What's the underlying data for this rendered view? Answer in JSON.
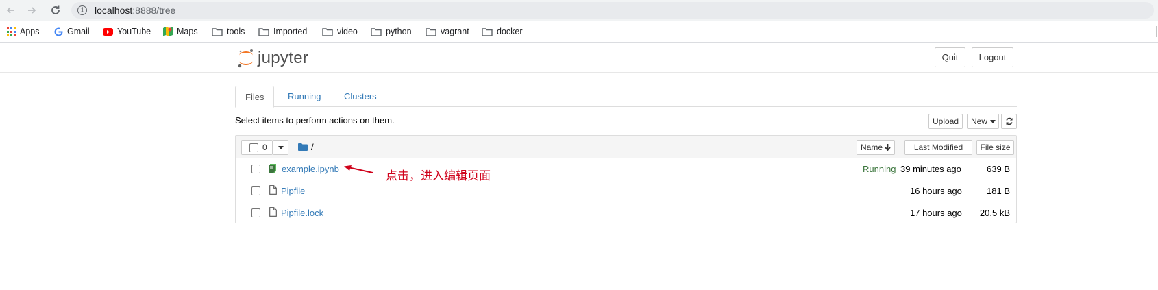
{
  "browser": {
    "url_host": "localhost",
    "url_path": ":8888/tree",
    "bookmarks": [
      {
        "label": "Apps",
        "icon": "apps-grid-icon"
      },
      {
        "label": "Gmail",
        "icon": "google-g-icon"
      },
      {
        "label": "YouTube",
        "icon": "youtube-icon"
      },
      {
        "label": "Maps",
        "icon": "maps-icon"
      },
      {
        "label": "tools",
        "icon": "folder-icon"
      },
      {
        "label": "Imported",
        "icon": "folder-icon"
      },
      {
        "label": "video",
        "icon": "folder-icon"
      },
      {
        "label": "python",
        "icon": "folder-icon"
      },
      {
        "label": "vagrant",
        "icon": "folder-icon"
      },
      {
        "label": "docker",
        "icon": "folder-icon"
      }
    ]
  },
  "header": {
    "logo_text": "jupyter",
    "quit_label": "Quit",
    "logout_label": "Logout"
  },
  "tabs": [
    {
      "label": "Files",
      "active": true
    },
    {
      "label": "Running",
      "active": false
    },
    {
      "label": "Clusters",
      "active": false
    }
  ],
  "toolbar": {
    "select_message": "Select items to perform actions on them.",
    "upload_label": "Upload",
    "new_label": "New",
    "selected_count": "0",
    "breadcrumb": "/"
  },
  "columns": {
    "name": "Name",
    "last_modified": "Last Modified",
    "file_size": "File size"
  },
  "files": [
    {
      "name": "example.ipynb",
      "type": "notebook",
      "status": "Running",
      "modified": "39 minutes ago",
      "size": "639 B"
    },
    {
      "name": "Pipfile",
      "type": "file",
      "status": "",
      "modified": "16 hours ago",
      "size": "181 B"
    },
    {
      "name": "Pipfile.lock",
      "type": "file",
      "status": "",
      "modified": "17 hours ago",
      "size": "20.5 kB"
    }
  ],
  "annotation": {
    "text": "点击，进入编辑页面"
  },
  "colors": {
    "link": "#337ab7",
    "running": "#3c763d",
    "annotation": "#d0021b",
    "jupyter_orange": "#f37726"
  }
}
